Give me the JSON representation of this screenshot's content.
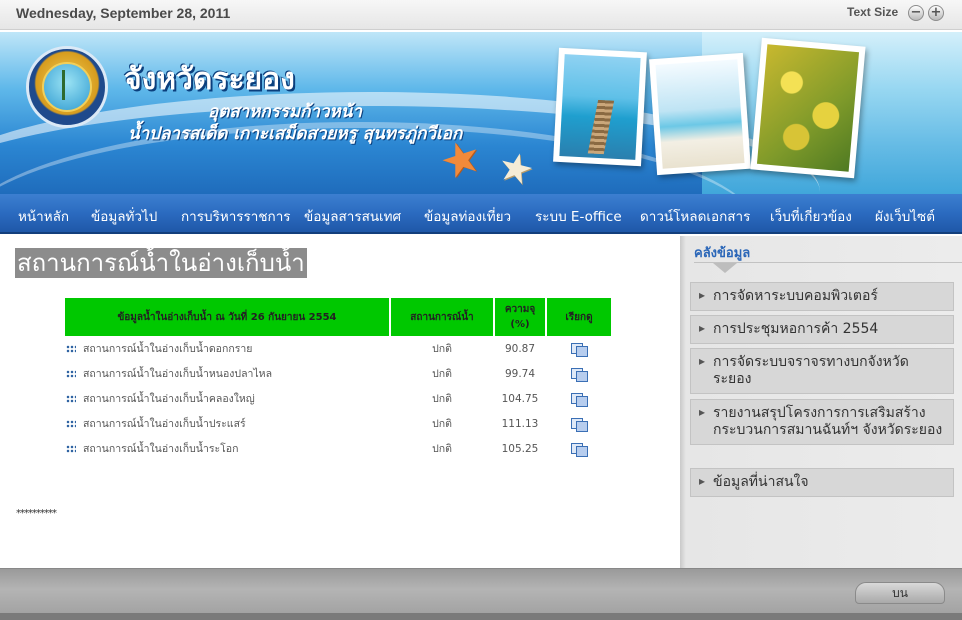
{
  "topbar": {
    "date": "Wednesday, September 28, 2011",
    "text_size_label": "Text Size",
    "decrease_glyph": "−",
    "increase_glyph": "+"
  },
  "banner": {
    "province_name": "จังหวัดระยอง",
    "slogan_line1": "อุตสาหกรรมก้าวหน้า",
    "slogan_line2": "น้ำปลารสเด็ด เกาะเสม็ดสวยหรู สุนทรภู่กวีเอก"
  },
  "nav": {
    "items": [
      "หน้าหลัก",
      "ข้อมูลทั่วไป",
      "การบริหารราชการ",
      "ข้อมูลสารสนเทศ",
      "ข้อมูลท่องเที่ยว",
      "ระบบ E-office",
      "ดาวน์โหลดเอกสาร",
      "เว็บที่เกี่ยวข้อง",
      "ผังเว็บไซต์"
    ]
  },
  "main": {
    "title": "สถานการณ์น้ำในอ่างเก็บน้ำ",
    "table": {
      "headers": [
        "ข้อมูลน้ำในอ่างเก็บน้ำ ณ วันที่ 26 กันยายน 2554",
        "สถานการณ์น้ำ",
        "ความจุ (%)",
        "เรียกดู"
      ],
      "rows": [
        {
          "name": "สถานการณ์น้ำในอ่างเก็บน้ำดอกกราย",
          "status": "ปกติ",
          "capacity": "90.87"
        },
        {
          "name": "สถานการณ์น้ำในอ่างเก็บน้ำหนองปลาไหล",
          "status": "ปกติ",
          "capacity": "99.74"
        },
        {
          "name": "สถานการณ์น้ำในอ่างเก็บน้ำคลองใหญ่",
          "status": "ปกติ",
          "capacity": "104.75"
        },
        {
          "name": "สถานการณ์น้ำในอ่างเก็บน้ำประแสร์",
          "status": "ปกติ",
          "capacity": "111.13"
        },
        {
          "name": "สถานการณ์น้ำในอ่างเก็บน้ำระโอก",
          "status": "ปกติ",
          "capacity": "105.25"
        }
      ]
    },
    "footnote": "**********"
  },
  "sidebar": {
    "heading": "คลังข้อมูล",
    "items": [
      "การจัดหาระบบคอมพิวเตอร์",
      "การประชุมหอการค้า 2554",
      "การจัดระบบจราจรทางบกจังหวัดระยอง",
      "รายงานสรุปโครงการการเสริมสร้างกระบวนการสมานฉันท์ฯ จังหวัดระยอง",
      "ข้อมูลที่น่าสนใจ"
    ]
  },
  "footer": {
    "top_button": "บน"
  },
  "colors": {
    "nav_blue": "#2b6bc0",
    "table_header_green": "#00c800",
    "sidebar_heading_blue": "#2a66b8"
  }
}
